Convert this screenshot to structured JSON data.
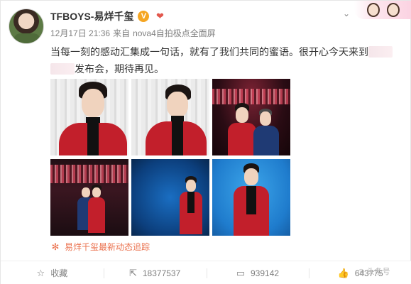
{
  "post": {
    "username": "TFBOYS-易烊千玺",
    "verified_badge": "V",
    "timestamp": "12月17日 21:36",
    "source_prefix": "来自",
    "source": "nova4自拍极点全面屏",
    "text_line1": "当每一刻的感动汇集成一句话，就有了我们共同的蜜语。很开心今天来到",
    "text_line2": "发布会，期待再见。",
    "tracking_label": "易烊千玺最新动态追踪"
  },
  "photos": [
    {
      "label": "photo-1"
    },
    {
      "label": "photo-2"
    },
    {
      "label": "photo-3"
    },
    {
      "label": "photo-4"
    },
    {
      "label": "photo-5"
    },
    {
      "label": "photo-6"
    }
  ],
  "footer": {
    "favorite_label": "收藏",
    "repost_count": "18377537",
    "comment_count": "939142",
    "like_count": "643775"
  },
  "watermark": "头条号",
  "colors": {
    "accent_orange": "#eb7350",
    "coat_red": "#c21f2b",
    "verified": "#f5a623"
  }
}
